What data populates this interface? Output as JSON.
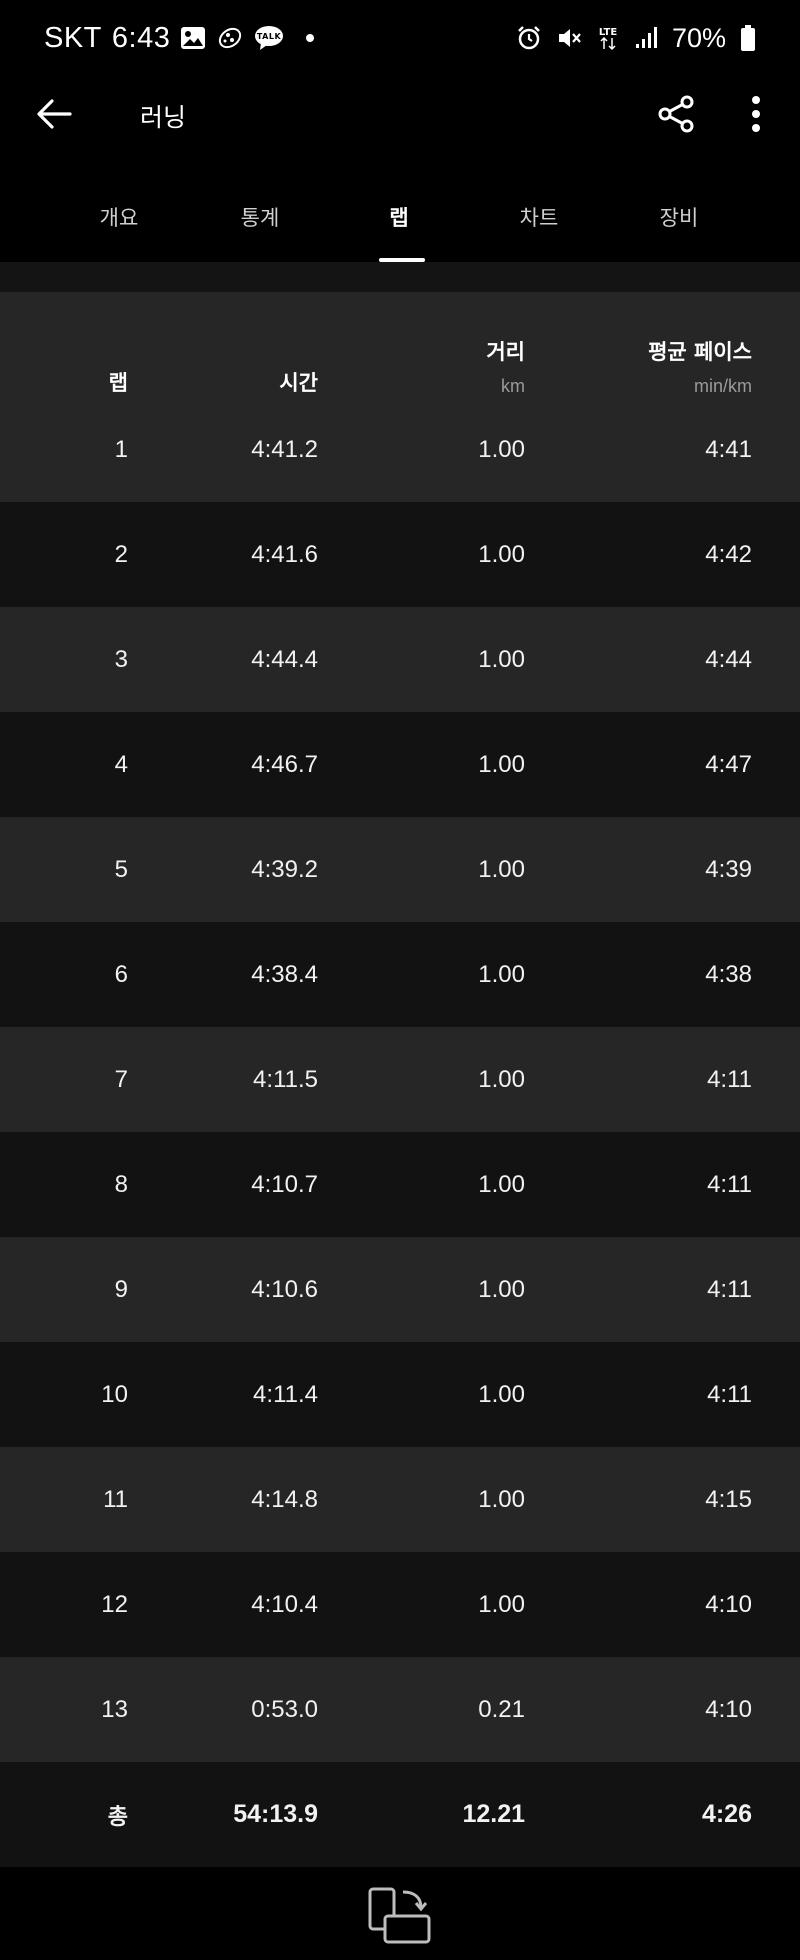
{
  "status_bar": {
    "carrier": "SKT",
    "time": "6:43",
    "battery": "70%",
    "network": "LTE",
    "icons_left": [
      "image-icon",
      "app-icon",
      "talk-icon"
    ],
    "talk_label": "TALK"
  },
  "app_bar": {
    "title": "러닝"
  },
  "tabs": [
    {
      "label": "개요",
      "active": false
    },
    {
      "label": "통계",
      "active": false
    },
    {
      "label": "랩",
      "active": true
    },
    {
      "label": "차트",
      "active": false
    },
    {
      "label": "장비",
      "active": false
    }
  ],
  "table": {
    "headers": {
      "lap": "랩",
      "time": "시간",
      "distance": "거리",
      "distance_unit": "km",
      "pace": "평균 페이스",
      "pace_unit": "min/km"
    },
    "rows": [
      {
        "lap": "1",
        "time": "4:41.2",
        "distance": "1.00",
        "pace": "4:41"
      },
      {
        "lap": "2",
        "time": "4:41.6",
        "distance": "1.00",
        "pace": "4:42"
      },
      {
        "lap": "3",
        "time": "4:44.4",
        "distance": "1.00",
        "pace": "4:44"
      },
      {
        "lap": "4",
        "time": "4:46.7",
        "distance": "1.00",
        "pace": "4:47"
      },
      {
        "lap": "5",
        "time": "4:39.2",
        "distance": "1.00",
        "pace": "4:39"
      },
      {
        "lap": "6",
        "time": "4:38.4",
        "distance": "1.00",
        "pace": "4:38"
      },
      {
        "lap": "7",
        "time": "4:11.5",
        "distance": "1.00",
        "pace": "4:11"
      },
      {
        "lap": "8",
        "time": "4:10.7",
        "distance": "1.00",
        "pace": "4:11"
      },
      {
        "lap": "9",
        "time": "4:10.6",
        "distance": "1.00",
        "pace": "4:11"
      },
      {
        "lap": "10",
        "time": "4:11.4",
        "distance": "1.00",
        "pace": "4:11"
      },
      {
        "lap": "11",
        "time": "4:14.8",
        "distance": "1.00",
        "pace": "4:15"
      },
      {
        "lap": "12",
        "time": "4:10.4",
        "distance": "1.00",
        "pace": "4:10"
      },
      {
        "lap": "13",
        "time": "0:53.0",
        "distance": "0.21",
        "pace": "4:10"
      }
    ],
    "total": {
      "lap": "총",
      "time": "54:13.9",
      "distance": "12.21",
      "pace": "4:26"
    }
  },
  "colors": {
    "background": "#000000",
    "row_light": "#262626",
    "row_dark": "#121212",
    "text": "#f2f2f2",
    "unit_text": "#9a9a9a"
  }
}
